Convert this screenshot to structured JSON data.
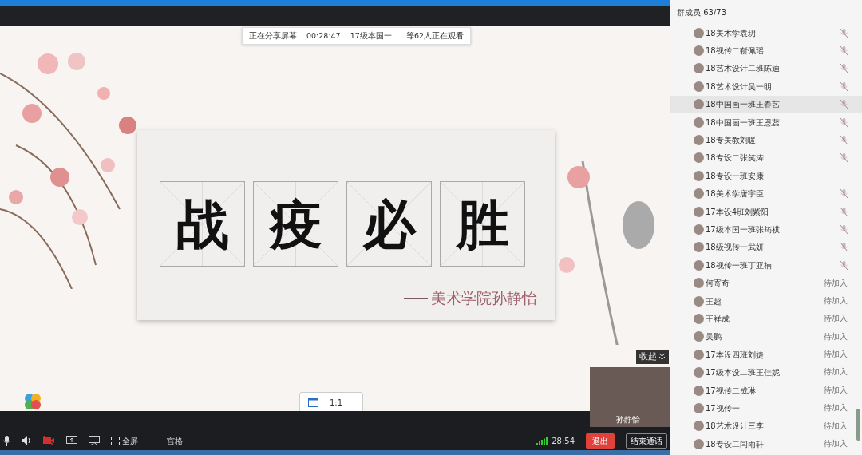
{
  "share_status": {
    "status": "正在分享屏幕",
    "timer": "00:28:47",
    "viewers": "17级本国一......等62人正在观看"
  },
  "slide": {
    "characters": [
      "战",
      "疫",
      "必",
      "胜"
    ],
    "author": "美术学院孙静怡"
  },
  "view_button": {
    "label": "1:1"
  },
  "video": {
    "collapse_label": "收起",
    "caption": "孙静怡"
  },
  "toolbar": {
    "fullscreen": "全屏",
    "grid": "宫格",
    "duration": "28:54",
    "exit": "退出",
    "end_call": "结束通话"
  },
  "members": {
    "title": "群成员 63/73",
    "items": [
      {
        "name": "18美术学袁玥",
        "muted": true,
        "selected": false
      },
      {
        "name": "18视传二靳佩瑶",
        "muted": true,
        "selected": false
      },
      {
        "name": "18艺术设计二班陈迪",
        "muted": true,
        "selected": false
      },
      {
        "name": "18艺术设计吴一明",
        "muted": true,
        "selected": false
      },
      {
        "name": "18中国画一班王春艺",
        "muted": true,
        "selected": true
      },
      {
        "name": "18中国画一班王恩蕊",
        "muted": true,
        "selected": false
      },
      {
        "name": "18专美教刘暖",
        "muted": true,
        "selected": false
      },
      {
        "name": "18专设二张笑涛",
        "muted": true,
        "selected": false
      },
      {
        "name": "18专设一班安康",
        "muted": false,
        "selected": false
      },
      {
        "name": "18美术学唐宇臣",
        "muted": true,
        "selected": false
      },
      {
        "name": "17本设4班刘紫阳",
        "muted": true,
        "selected": false
      },
      {
        "name": "17级本国一班张筠祺",
        "muted": true,
        "selected": false
      },
      {
        "name": "18级视传一武妍",
        "muted": true,
        "selected": false
      },
      {
        "name": "18视传一班丁亚楠",
        "muted": true,
        "selected": false
      },
      {
        "name": "何寄奇",
        "muted": false,
        "status_text": "待加入",
        "selected": false
      },
      {
        "name": "王超",
        "muted": false,
        "status_text": "待加入",
        "selected": false
      },
      {
        "name": "王祥成",
        "muted": false,
        "status_text": "待加入",
        "selected": false
      },
      {
        "name": "吴鹏",
        "muted": false,
        "status_text": "待加入",
        "selected": false
      },
      {
        "name": "17本设四班刘婕",
        "muted": false,
        "status_text": "待加入",
        "selected": false
      },
      {
        "name": "17级本设二班王佳妮",
        "muted": false,
        "status_text": "待加入",
        "selected": false
      },
      {
        "name": "17视传二成琳",
        "muted": false,
        "status_text": "待加入",
        "selected": false
      },
      {
        "name": "17视传一",
        "muted": false,
        "status_text": "待加入",
        "selected": false
      },
      {
        "name": "18艺术设计三李",
        "muted": false,
        "status_text": "待加入",
        "selected": false
      },
      {
        "name": "18专设二闫雨轩",
        "muted": false,
        "status_text": "待加入",
        "selected": false
      }
    ]
  }
}
